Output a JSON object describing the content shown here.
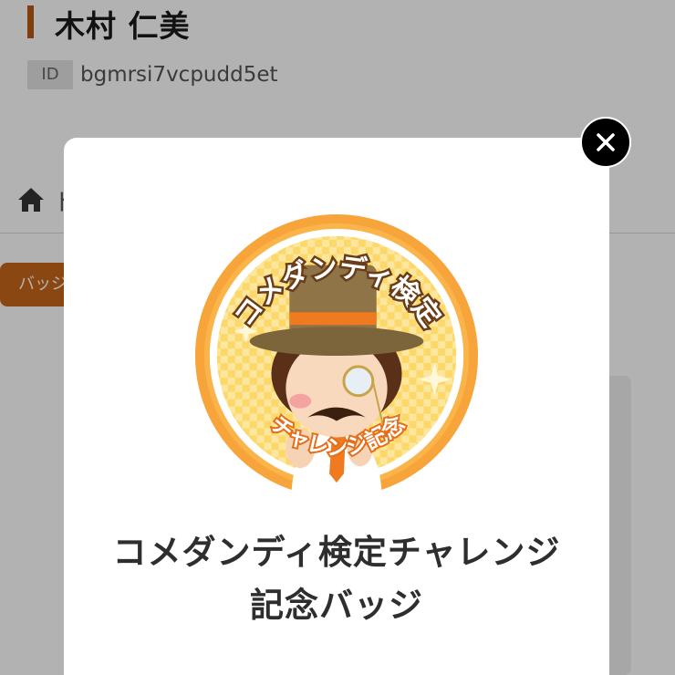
{
  "profile": {
    "name": "木村 仁美",
    "id_label": "ID",
    "id_value": "bgmrsi7vcpudd5et"
  },
  "breadcrumb": {
    "text": "ト"
  },
  "tabs": {
    "active_label": "バッジ"
  },
  "modal": {
    "title": "コメダンディ検定チャレンジ記念バッジ",
    "badge": {
      "top_text": "コメダンディ検定",
      "bottom_text": "チャレンジ記念"
    }
  },
  "colors": {
    "accent": "#c8661a",
    "badge_orange": "#f08a1c",
    "badge_yellow": "#fbd96a"
  },
  "icons": {
    "home": "home-icon",
    "close": "close-icon"
  }
}
